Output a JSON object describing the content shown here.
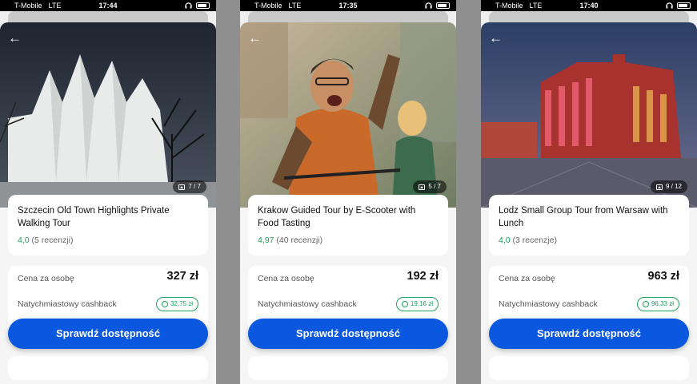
{
  "colors": {
    "accent": "#0a58e0",
    "rating_green": "#1aa35b"
  },
  "icons": [
    "headphones-icon",
    "battery-icon",
    "back-arrow-icon",
    "image-icon",
    "coin-icon"
  ],
  "screens": [
    {
      "status": {
        "carrier": "T-Mobile",
        "network": "LTE",
        "time": "17:44"
      },
      "photo_counter": "7 / 7",
      "title": "Szczecin Old Town Highlights Private Walking Tour",
      "rating": "4,0",
      "reviews": "(5 recenzji)",
      "price_label": "Cena za osobę",
      "price": "327 zł",
      "cashback_label": "Natychmiastowy cashback",
      "cashback": "32,75 zł",
      "cta": "Sprawdź dostępność"
    },
    {
      "status": {
        "carrier": "T-Mobile",
        "network": "LTE",
        "time": "17:35"
      },
      "photo_counter": "5 / 7",
      "title": "Krakow Guided Tour by E-Scooter with Food Tasting",
      "rating": "4,97",
      "reviews": "(40 recenzji)",
      "price_label": "Cena za osobę",
      "price": "192 zł",
      "cashback_label": "Natychmiastowy cashback",
      "cashback": "19,16 zł",
      "cta": "Sprawdź dostępność"
    },
    {
      "status": {
        "carrier": "T-Mobile",
        "network": "LTE",
        "time": "17:40"
      },
      "photo_counter": "9 / 12",
      "title": "Lodz Small Group Tour from Warsaw with Lunch",
      "rating": "4,0",
      "reviews": "(3 recenzje)",
      "price_label": "Cena za osobę",
      "price": "963 zł",
      "cashback_label": "Natychmiastowy cashback",
      "cashback": "96,33 zł",
      "cta": "Sprawdź dostępność"
    }
  ]
}
